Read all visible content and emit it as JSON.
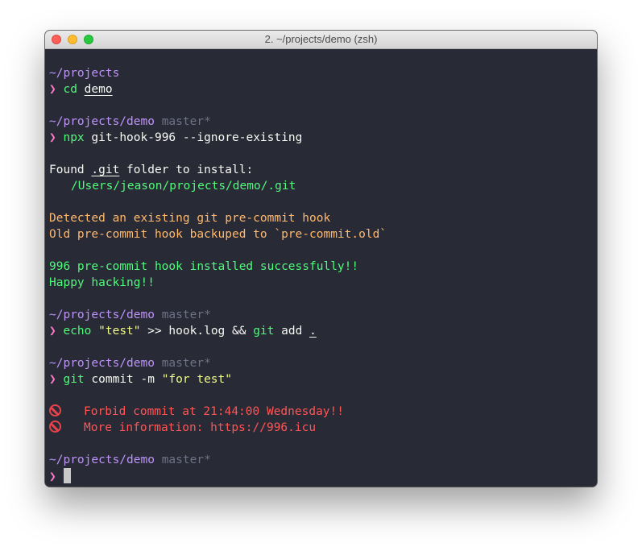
{
  "window": {
    "title": "2. ~/projects/demo (zsh)"
  },
  "prompt_symbol": "❯",
  "lines": {
    "p1_path": "~/projects",
    "c1_cmd": "cd",
    "c1_arg": "demo",
    "p2_path": "~/projects/demo",
    "p2_branch": "master*",
    "c2_cmd": "npx",
    "c2_rest": "git-hook-996 --ignore-existing",
    "o1_pre": "Found ",
    "o1_git": ".git",
    "o1_post": " folder to install:",
    "o2": "/Users/jeason/projects/demo/.git",
    "o3": "Detected an existing git pre-commit hook",
    "o4": "Old pre-commit hook backuped to `pre-commit.old`",
    "o5": "996 pre-commit hook installed successfully!!",
    "o6": "Happy hacking!!",
    "p3_path": "~/projects/demo",
    "p3_branch": "master*",
    "c3_cmd": "echo",
    "c3_str": "\"test\"",
    "c3_mid": " >> hook.log && ",
    "c3_git": "git",
    "c3_add": " add ",
    "c3_dot": ".",
    "p4_path": "~/projects/demo",
    "p4_branch": "master*",
    "c4_cmd": "git",
    "c4_rest": " commit -m ",
    "c4_str": "\"for test\"",
    "e1": "Forbid commit at 21:44:00 Wednesday!!",
    "e2": "More information: https://996.icu",
    "p5_path": "~/projects/demo",
    "p5_branch": "master*"
  },
  "icons": {
    "error": "no-entry-icon"
  },
  "colors": {
    "background": "#282a36",
    "path": "#bd93f9",
    "prompt": "#ff79c6",
    "command": "#50fa7b",
    "string": "#f1fa8c",
    "warning": "#ffb86c",
    "success": "#50fa7b",
    "error": "#ff5555",
    "branch": "#6f7187"
  }
}
